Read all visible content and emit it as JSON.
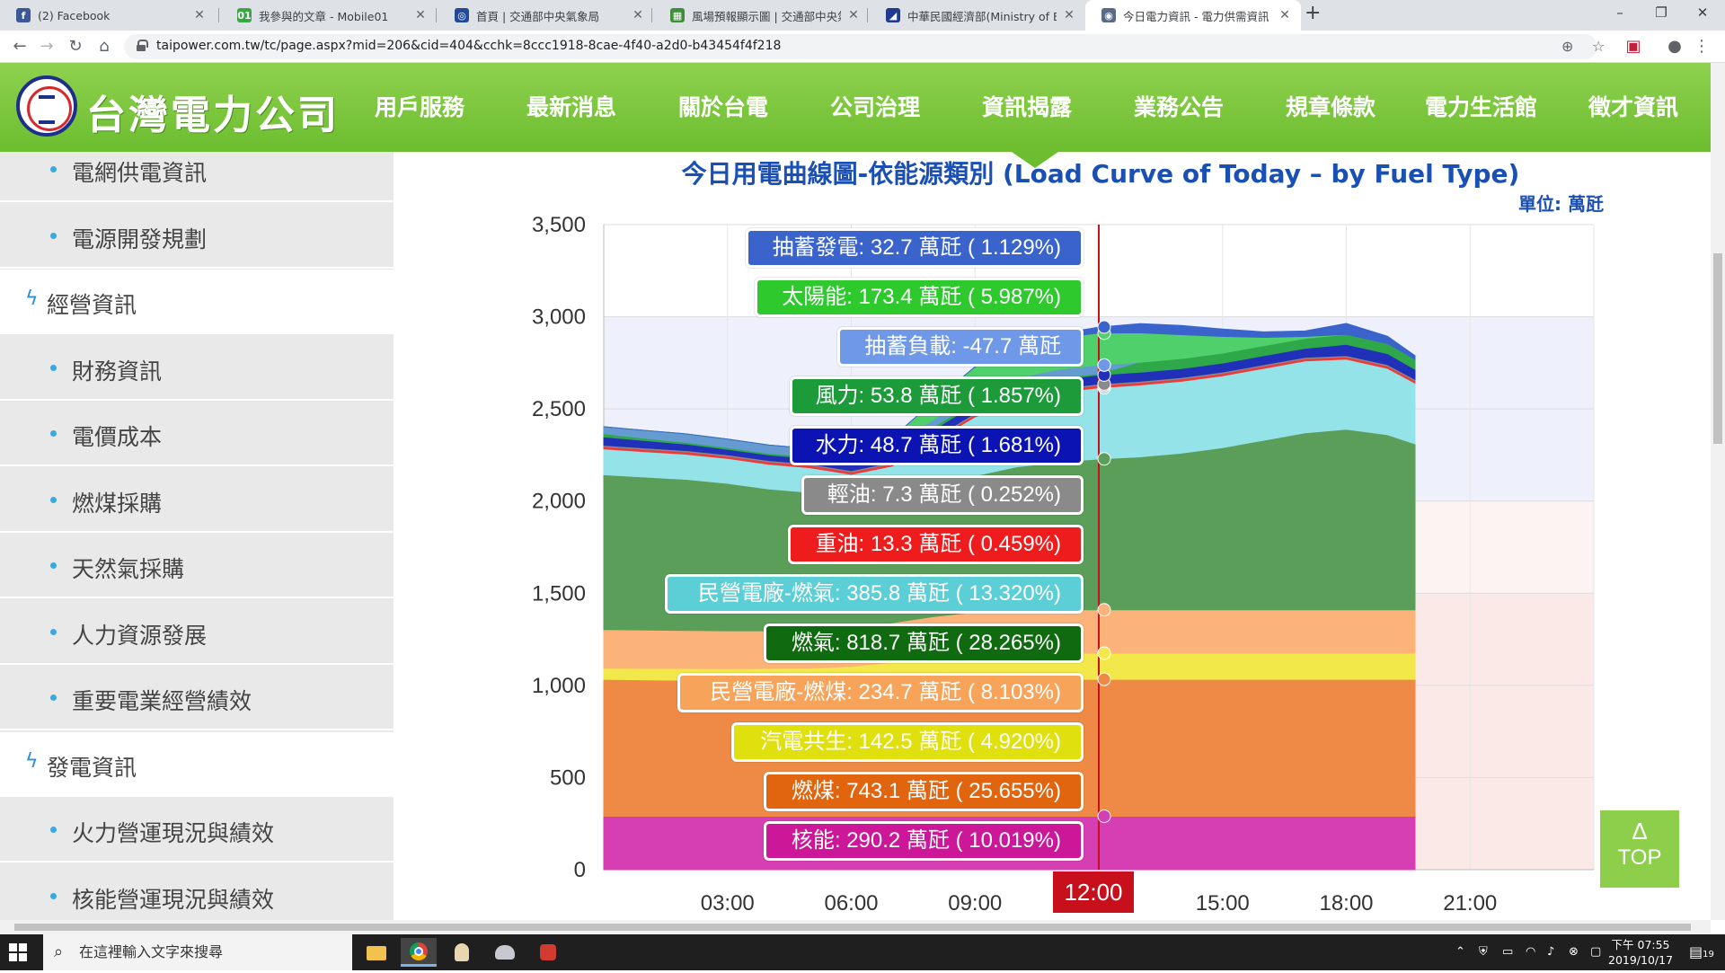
{
  "browser": {
    "tabs": [
      {
        "title": "(2) Facebook",
        "favicon": "facebook-icon",
        "color": "#3b5998",
        "glyph": "f"
      },
      {
        "title": "我參與的文章 - Mobile01",
        "favicon": "mobile01-icon",
        "color": "#3ca546",
        "glyph": "01"
      },
      {
        "title": "首頁 | 交通部中央氣象局",
        "favicon": "cwb-icon",
        "color": "#214a9a",
        "glyph": "◎"
      },
      {
        "title": "風場預報顯示圖 | 交通部中央氣象局",
        "favicon": "map-icon",
        "color": "#3f8f3a",
        "glyph": "▦"
      },
      {
        "title": "中華民國經濟部(Ministry of Economic Affairs)",
        "favicon": "moea-icon",
        "color": "#1f3b8f",
        "glyph": "◢"
      },
      {
        "title": "今日電力資訊 - 電力供需資訊 - 資訊揭露",
        "favicon": "taipower-icon",
        "color": "#5a6b8a",
        "glyph": "◉"
      }
    ],
    "url": "taipower.com.tw/tc/page.aspx?mid=206&cid=404&cchk=8ccc1918-8cae-4f40-a2d0-b43454f4f218"
  },
  "site": {
    "logo_text": "台灣電力公司",
    "nav": [
      "用戶服務",
      "最新消息",
      "關於台電",
      "公司治理",
      "資訊揭露",
      "業務公告",
      "規章條款",
      "電力生活館",
      "徵才資訊"
    ]
  },
  "sidebar": {
    "items": [
      {
        "label": "電網供電資訊",
        "section": false
      },
      {
        "label": "電源開發規劃",
        "section": false
      },
      {
        "label": "經營資訊",
        "section": true
      },
      {
        "label": "財務資訊",
        "section": false
      },
      {
        "label": "電價成本",
        "section": false
      },
      {
        "label": "燃煤採購",
        "section": false
      },
      {
        "label": "天然氣採購",
        "section": false
      },
      {
        "label": "人力資源發展",
        "section": false
      },
      {
        "label": "重要電業經營績效",
        "section": false
      },
      {
        "label": "發電資訊",
        "section": true
      },
      {
        "label": "火力營運現況與績效",
        "section": false
      },
      {
        "label": "核能營運現況與績效",
        "section": false
      }
    ]
  },
  "chart_data": {
    "type": "area",
    "title": "今日用電曲線圖-依能源類別 (Load Curve of Today – by Fuel Type)",
    "unit_label": "單位: 萬瓩",
    "y_ticks": [
      "0",
      "500",
      "1,000",
      "1,500",
      "2,000",
      "2,500",
      "3,000",
      "3,500"
    ],
    "ylim": [
      0,
      3500
    ],
    "x_ticks": [
      "03:00",
      "06:00",
      "09:00",
      "12:00",
      "15:00",
      "18:00",
      "21:00"
    ],
    "xlim": [
      "00:00",
      "24:00"
    ],
    "highlight_time": "12:00",
    "stacked": true,
    "x": [
      "00:00",
      "01:00",
      "02:00",
      "03:00",
      "04:00",
      "05:00",
      "06:00",
      "07:00",
      "08:00",
      "09:00",
      "10:00",
      "11:00",
      "12:00",
      "13:00",
      "14:00",
      "15:00",
      "16:00",
      "17:00",
      "18:00",
      "19:00",
      "19:40"
    ],
    "series": [
      {
        "name": "核能",
        "color": "#d63fb4",
        "values": [
          290,
          290,
          290,
          290,
          290,
          290,
          290,
          290,
          290,
          290,
          290,
          290,
          290,
          290,
          290,
          290,
          290,
          290,
          290,
          290,
          290
        ]
      },
      {
        "name": "燃煤",
        "color": "#ee8a45",
        "values": [
          743,
          740,
          738,
          735,
          734,
          733,
          733,
          735,
          738,
          740,
          742,
          743,
          743,
          743,
          743,
          743,
          743,
          743,
          743,
          743,
          743
        ]
      },
      {
        "name": "汽電共生",
        "color": "#f2e84a",
        "values": [
          60,
          62,
          64,
          66,
          68,
          70,
          80,
          100,
          120,
          135,
          140,
          142,
          142,
          142,
          142,
          142,
          142,
          142,
          142,
          142,
          142
        ]
      },
      {
        "name": "民營電廠-燃煤",
        "color": "#fcb37a",
        "values": [
          210,
          208,
          206,
          205,
          204,
          204,
          206,
          215,
          225,
          232,
          234,
          235,
          235,
          235,
          235,
          235,
          235,
          235,
          235,
          235,
          235
        ]
      },
      {
        "name": "燃氣",
        "color": "#5b9e5a",
        "values": [
          840,
          830,
          820,
          800,
          770,
          750,
          700,
          680,
          700,
          740,
          780,
          800,
          819,
          830,
          850,
          880,
          920,
          960,
          980,
          950,
          900
        ]
      },
      {
        "name": "民營電廠-燃氣",
        "color": "#94e3e8",
        "values": [
          140,
          138,
          136,
          135,
          134,
          134,
          136,
          170,
          250,
          320,
          360,
          380,
          386,
          390,
          390,
          390,
          390,
          390,
          380,
          360,
          330
        ]
      },
      {
        "name": "重油",
        "color": "#ee3a3a",
        "values": [
          13,
          13,
          13,
          13,
          13,
          13,
          13,
          13,
          13,
          13,
          13,
          13,
          13,
          13,
          13,
          13,
          13,
          13,
          13,
          13,
          13
        ]
      },
      {
        "name": "輕油",
        "color": "#8a8a8a",
        "values": [
          7,
          7,
          7,
          7,
          7,
          7,
          7,
          7,
          7,
          7,
          7,
          7,
          7,
          7,
          7,
          7,
          7,
          7,
          7,
          7,
          7
        ]
      },
      {
        "name": "水力",
        "color": "#2130b8",
        "values": [
          45,
          40,
          35,
          30,
          30,
          30,
          35,
          40,
          45,
          48,
          48,
          49,
          49,
          49,
          49,
          49,
          49,
          49,
          60,
          60,
          55
        ]
      },
      {
        "name": "風力",
        "color": "#2fa84a",
        "values": [
          55,
          55,
          55,
          55,
          54,
          54,
          54,
          54,
          54,
          54,
          54,
          54,
          54,
          54,
          54,
          54,
          54,
          54,
          54,
          54,
          54
        ]
      },
      {
        "name": "抽蓄負載",
        "color": "#6f99e8",
        "values": [
          -40,
          -45,
          -48,
          -48,
          -48,
          -45,
          -40,
          -30,
          -40,
          -45,
          -47,
          -48,
          -48,
          0,
          0,
          0,
          0,
          0,
          0,
          0,
          0
        ]
      },
      {
        "name": "太陽能",
        "color": "#4fd06a",
        "values": [
          0,
          0,
          0,
          0,
          0,
          0,
          5,
          40,
          100,
          150,
          170,
          173,
          173,
          160,
          130,
          90,
          45,
          10,
          0,
          0,
          0
        ]
      },
      {
        "name": "抽蓄發電",
        "color": "#3a64cc",
        "values": [
          0,
          0,
          0,
          0,
          0,
          0,
          0,
          0,
          0,
          0,
          0,
          20,
          33,
          50,
          50,
          40,
          30,
          30,
          60,
          40,
          20
        ]
      }
    ],
    "tooltip_labels": [
      {
        "text": "抽蓄發電: 32.7 萬瓩 ( 1.129%)",
        "color": "#3a64cc"
      },
      {
        "text": "太陽能: 173.4 萬瓩 ( 5.987%)",
        "color": "#2dc92d"
      },
      {
        "text": "抽蓄負載: -47.7 萬瓩",
        "color": "#6f99e8"
      },
      {
        "text": "風力: 53.8 萬瓩 ( 1.857%)",
        "color": "#1d9b3a"
      },
      {
        "text": "水力: 48.7 萬瓩 ( 1.681%)",
        "color": "#0c13b3"
      },
      {
        "text": "輕油: 7.3 萬瓩 ( 0.252%)",
        "color": "#8a8a8a"
      },
      {
        "text": "重油: 13.3 萬瓩 ( 0.459%)",
        "color": "#ee1c1c"
      },
      {
        "text": "民營電廠-燃氣: 385.8 萬瓩 ( 13.320%)",
        "color": "#5ccfd6"
      },
      {
        "text": "燃氣: 818.7 萬瓩 ( 28.265%)",
        "color": "#0f6a10"
      },
      {
        "text": "民營電廠-燃煤: 234.7 萬瓩 ( 8.103%)",
        "color": "#f7a45a"
      },
      {
        "text": "汽電共生: 142.5 萬瓩 ( 4.920%)",
        "color": "#e0e00e"
      },
      {
        "text": "燃煤: 743.1 萬瓩 ( 25.655%)",
        "color": "#e0650e"
      },
      {
        "text": "核能: 290.2 萬瓩 ( 10.019%)",
        "color": "#cc1799"
      }
    ]
  },
  "top_button": {
    "arrow": "Δ",
    "label": "TOP"
  },
  "taskbar": {
    "search_placeholder": "在這裡輸入文字來搜尋",
    "time": "下午 07:55",
    "date": "2019/10/17",
    "notifications": "19"
  }
}
